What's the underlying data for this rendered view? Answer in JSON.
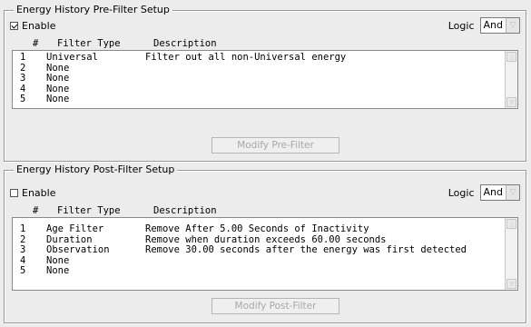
{
  "pre_filter": {
    "title": "Energy History Pre-Filter Setup",
    "enable_label": "Enable",
    "enable_checked": true,
    "logic_label": "Logic",
    "logic_value": "And",
    "columns": {
      "num": "#",
      "type": "Filter Type",
      "desc": "Description"
    },
    "rows": [
      {
        "num": "1",
        "type": "Universal",
        "desc": "Filter out all non-Universal energy"
      },
      {
        "num": "2",
        "type": "None",
        "desc": ""
      },
      {
        "num": "3",
        "type": "None",
        "desc": ""
      },
      {
        "num": "4",
        "type": "None",
        "desc": ""
      },
      {
        "num": "5",
        "type": "None",
        "desc": ""
      }
    ],
    "button_label": "Modify Pre-Filter"
  },
  "post_filter": {
    "title": "Energy History Post-Filter Setup",
    "enable_label": "Enable",
    "enable_checked": false,
    "logic_label": "Logic",
    "logic_value": "And",
    "columns": {
      "num": "#",
      "type": "Filter Type",
      "desc": "Description"
    },
    "rows": [
      {
        "num": "1",
        "type": "Age Filter",
        "desc": "Remove After 5.00 Seconds of Inactivity"
      },
      {
        "num": "2",
        "type": "Duration",
        "desc": "Remove when duration exceeds 60.00 seconds"
      },
      {
        "num": "3",
        "type": "Observation",
        "desc": "Remove 30.00 seconds after the energy was first detected"
      },
      {
        "num": "4",
        "type": "None",
        "desc": ""
      },
      {
        "num": "5",
        "type": "None",
        "desc": ""
      }
    ],
    "button_label": "Modify Post-Filter"
  }
}
